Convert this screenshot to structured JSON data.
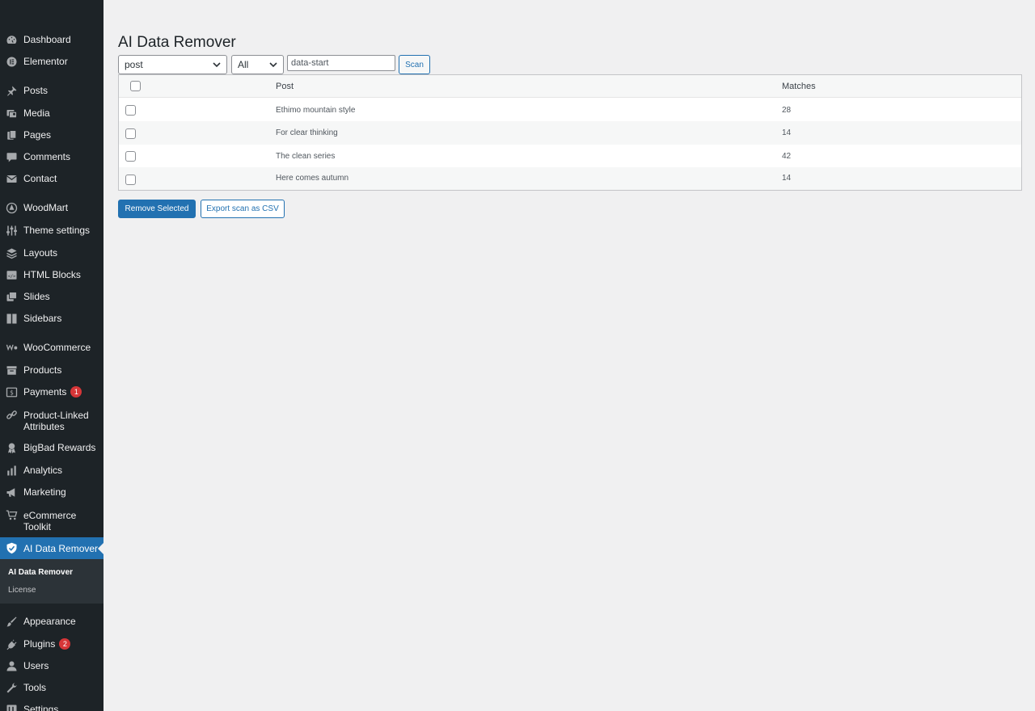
{
  "sidebar": {
    "items": [
      {
        "label": "Dashboard",
        "icon": "dashboard-icon",
        "badge": ""
      },
      {
        "label": "Elementor",
        "icon": "elementor-icon",
        "badge": ""
      },
      {
        "label": "Posts",
        "icon": "pin-icon",
        "badge": ""
      },
      {
        "label": "Media",
        "icon": "media-icon",
        "badge": ""
      },
      {
        "label": "Pages",
        "icon": "pages-icon",
        "badge": ""
      },
      {
        "label": "Comments",
        "icon": "comment-icon",
        "badge": ""
      },
      {
        "label": "Contact",
        "icon": "mail-icon",
        "badge": ""
      },
      {
        "label": "WoodMart",
        "icon": "woodmart-icon",
        "badge": ""
      },
      {
        "label": "Theme settings",
        "icon": "sliders-icon",
        "badge": ""
      },
      {
        "label": "Layouts",
        "icon": "layers-icon",
        "badge": ""
      },
      {
        "label": "HTML Blocks",
        "icon": "html-icon",
        "badge": ""
      },
      {
        "label": "Slides",
        "icon": "slides-icon",
        "badge": ""
      },
      {
        "label": "Sidebars",
        "icon": "sidebar-icon",
        "badge": ""
      },
      {
        "label": "WooCommerce",
        "icon": "woo-icon",
        "badge": ""
      },
      {
        "label": "Products",
        "icon": "archive-icon",
        "badge": ""
      },
      {
        "label": "Payments",
        "icon": "dollar-icon",
        "badge": "1"
      },
      {
        "label": "Product-Linked Attributes",
        "icon": "link-icon",
        "badge": ""
      },
      {
        "label": "BigBad Rewards",
        "icon": "award-icon",
        "badge": ""
      },
      {
        "label": "Analytics",
        "icon": "bar-chart-icon",
        "badge": ""
      },
      {
        "label": "Marketing",
        "icon": "megaphone-icon",
        "badge": ""
      },
      {
        "label": "eCommerce Toolkit",
        "icon": "cart-icon",
        "badge": ""
      },
      {
        "label": "AI Data Remover",
        "icon": "shield-icon",
        "badge": ""
      },
      {
        "label": "Appearance",
        "icon": "brush-icon",
        "badge": ""
      },
      {
        "label": "Plugins",
        "icon": "plugin-icon",
        "badge": "2"
      },
      {
        "label": "Users",
        "icon": "user-icon",
        "badge": ""
      },
      {
        "label": "Tools",
        "icon": "wrench-icon",
        "badge": ""
      },
      {
        "label": "Settings",
        "icon": "settings-icon",
        "badge": ""
      }
    ],
    "submenu": [
      {
        "label": "AI Data Remover"
      },
      {
        "label": "License"
      }
    ]
  },
  "main": {
    "title": "AI Data Remover",
    "post_type_select": "post",
    "filter_select": "All",
    "search_value": "data-start",
    "scan_label": "Scan",
    "table": {
      "columns": [
        "Post",
        "Matches"
      ],
      "rows": [
        {
          "post": "Ethimo mountain style",
          "matches": "28"
        },
        {
          "post": "For clear thinking",
          "matches": "14"
        },
        {
          "post": "The clean series",
          "matches": "42"
        },
        {
          "post": "Here comes autumn",
          "matches": "14"
        }
      ]
    },
    "remove_label": "Remove Selected",
    "export_label": "Export scan as CSV"
  },
  "colors": {
    "sidebar_bg": "#1d2327",
    "accent": "#2271b1",
    "badge": "#d63638"
  }
}
